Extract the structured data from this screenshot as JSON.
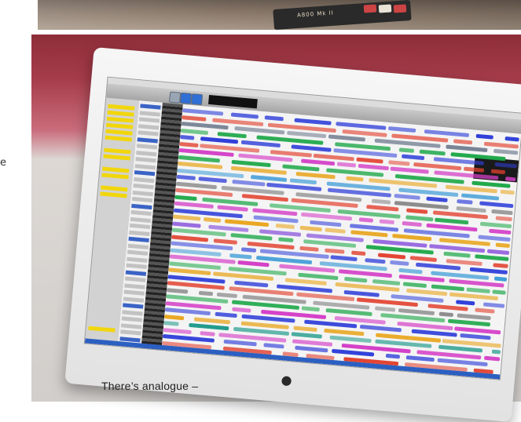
{
  "caption": "There’s analogue –",
  "stray_letter": "e",
  "device_label": "A800 Mk II",
  "colors": {
    "rack": "#7b6c60",
    "desk": "#a33443",
    "bezel": "#efefef",
    "screen": "#f4f4f4",
    "sidebar_highlight": "#f1d60c",
    "transport_display": "#7ff86a",
    "selection_blue": "#2f6fd6"
  },
  "icons": [
    "apple-logo-icon"
  ],
  "track_colors": [
    "#2f3fd9",
    "#e2412f",
    "#6e7a8e",
    "#1fa84a",
    "#2f3fd9",
    "#e2412f",
    "#d43fc7",
    "#1fa84a",
    "#e8a51c",
    "#3b9ad6",
    "#2f3fd9",
    "#8b8b8b",
    "#e2412f",
    "#1fa84a",
    "#d43fc7",
    "#2f3fd9",
    "#e8a51c",
    "#7b3fd9",
    "#1fa84a",
    "#e2412f",
    "#2f3fd9",
    "#3b9ad6",
    "#d43fc7",
    "#1fa84a",
    "#e8a51c",
    "#2f3fd9",
    "#e2412f",
    "#8b8b8b",
    "#1fa84a",
    "#d43fc7",
    "#2f3fd9",
    "#e8a51c",
    "#1f9a8a",
    "#d43fc7",
    "#2f3fd9",
    "#e2412f"
  ]
}
